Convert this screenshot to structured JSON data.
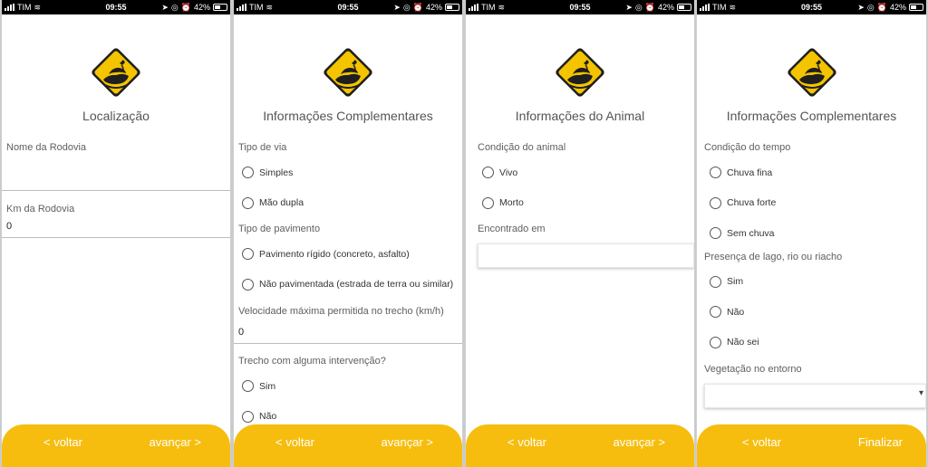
{
  "colors": {
    "accent": "#f6bd0e",
    "logo_yellow": "#f5c400",
    "text": "#555555"
  },
  "statusbar": {
    "carrier": "TIM",
    "time": "09:55",
    "battery": "42%"
  },
  "screens": [
    {
      "title": "Localização",
      "fields": [
        {
          "label": "Nome da Rodovia",
          "value": ""
        },
        {
          "label": "Km da Rodovia",
          "value": "0"
        }
      ],
      "back": "< voltar",
      "next": "avançar >"
    },
    {
      "title": "Informações Complementares",
      "road_type": {
        "label": "Tipo de via",
        "options": [
          "Simples",
          "Mão dupla"
        ]
      },
      "pavement": {
        "label": "Tipo de pavimento",
        "options": [
          "Pavimento rígido (concreto, asfalto)",
          "Não pavimentada (estrada de terra ou similar)"
        ]
      },
      "speed": {
        "label": "Velocidade máxima permitida no trecho (km/h)",
        "value": "0"
      },
      "intervention": {
        "label": "Trecho com alguma intervenção?",
        "options": [
          "Sim",
          "Não"
        ]
      },
      "back": "< voltar",
      "next": "avançar >"
    },
    {
      "title": "Informações do Animal",
      "condition": {
        "label": "Condição do animal",
        "options": [
          "Vivo",
          "Morto"
        ]
      },
      "found_in": {
        "label": "Encontrado em",
        "value": ""
      },
      "back": "< voltar",
      "next": "avançar >"
    },
    {
      "title": "Informações Complementares",
      "weather": {
        "label": "Condição do tempo",
        "options": [
          "Chuva fina",
          "Chuva forte",
          "Sem chuva"
        ]
      },
      "water": {
        "label": "Presença de lago, rio ou riacho",
        "options": [
          "Sim",
          "Não",
          "Não sei"
        ]
      },
      "vegetation": {
        "label": "Vegetação no entorno",
        "value": ""
      },
      "back": "< voltar",
      "next": "Finalizar"
    }
  ]
}
